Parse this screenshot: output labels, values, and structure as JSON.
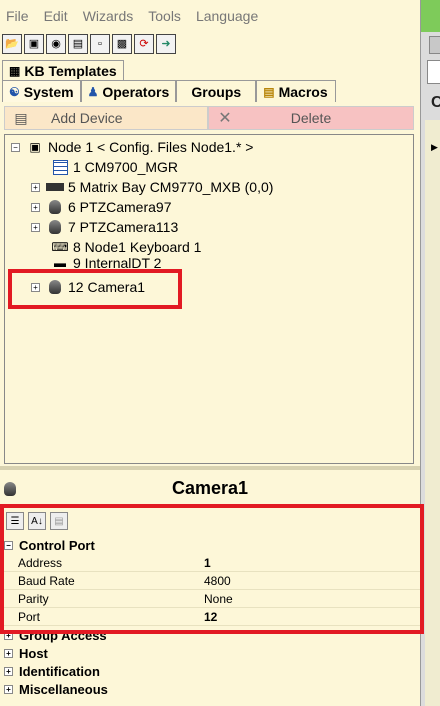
{
  "menu": [
    "File",
    "Edit",
    "Wizards",
    "Tools",
    "Language"
  ],
  "toolbar_icons": [
    "open-icon",
    "save-icon",
    "find-icon",
    "properties-icon",
    "page-icon",
    "print-icon",
    "refresh-icon",
    "exit-icon"
  ],
  "tabs": {
    "kb_templates": "KB Templates",
    "system": "System",
    "operators": "Operators",
    "groups": "Groups",
    "macros": "Macros"
  },
  "actions": {
    "add_device": "Add Device",
    "delete": "Delete"
  },
  "tree": {
    "root": "Node 1 < Config. Files Node1.* >",
    "items": [
      "1 CM9700_MGR",
      "5 Matrix Bay CM9770_MXB (0,0)",
      "6 PTZCamera97",
      "7 PTZCamera113",
      "8 Node1 Keyboard 1",
      "9 InternalDT 2",
      "12 Camera1"
    ]
  },
  "properties": {
    "title": "Camera1",
    "category_control_port": "Control Port",
    "rows": [
      {
        "name": "Address",
        "value": "1"
      },
      {
        "name": "Baud Rate",
        "value": "4800"
      },
      {
        "name": "Parity",
        "value": "None"
      },
      {
        "name": "Port",
        "value": "12"
      }
    ],
    "collapsed_categories": [
      "Group Access",
      "Host",
      "Identification",
      "Miscellaneous"
    ]
  },
  "colors": {
    "background": "#fdf7d8",
    "add_button": "#fbe7c8",
    "delete_button": "#f7c2c2",
    "highlight": "#e21a23"
  }
}
